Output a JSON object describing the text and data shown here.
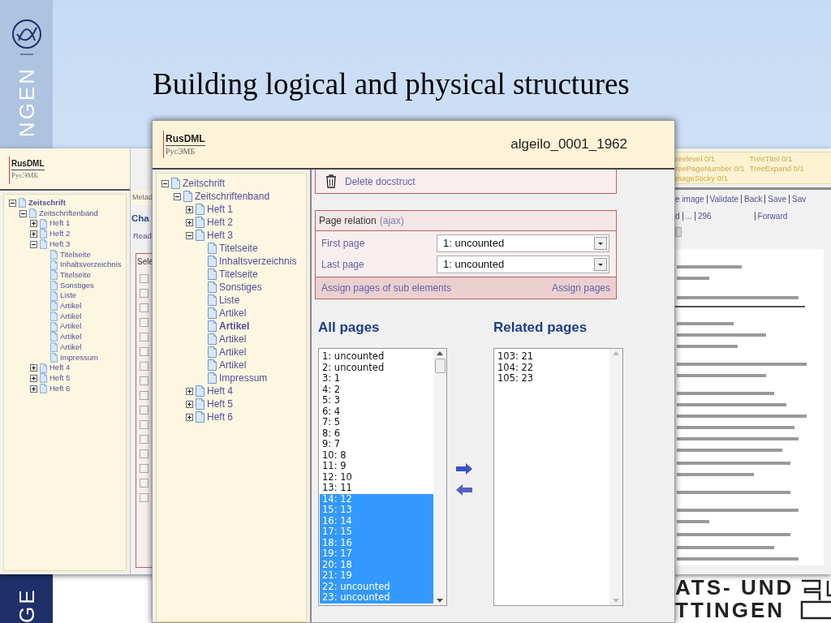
{
  "slide": {
    "title": "Building logical and physical structures",
    "side_text_top": "NGEN",
    "side_text_bottom": "GE",
    "footer_lines": [
      "ATS- UND",
      "TTINGEN"
    ]
  },
  "back_window": {
    "logo": {
      "name": "RusDML",
      "sub": "РусЭМБ"
    },
    "tree": [
      {
        "label": "Zeitschrift",
        "expanded": true,
        "selected": true,
        "children": [
          {
            "label": "Zeitschriftenband",
            "expanded": true,
            "selected": false,
            "children": [
              {
                "label": "Heft 1",
                "expanded": false,
                "selected": false
              },
              {
                "label": "Heft 2",
                "expanded": false,
                "selected": false
              },
              {
                "label": "Heft 3",
                "expanded": true,
                "selected": false,
                "children": [
                  {
                    "label": "Titelseite",
                    "selected": false
                  },
                  {
                    "label": "Inhaltsverzeichnis",
                    "selected": false
                  },
                  {
                    "label": "Titelseite",
                    "selected": false
                  },
                  {
                    "label": "Sonstiges",
                    "selected": false
                  },
                  {
                    "label": "Liste",
                    "selected": false
                  },
                  {
                    "label": "Artikel",
                    "selected": false
                  },
                  {
                    "label": "Artikel",
                    "selected": false
                  },
                  {
                    "label": "Artikel",
                    "selected": false
                  },
                  {
                    "label": "Artikel",
                    "selected": false
                  },
                  {
                    "label": "Artikel",
                    "selected": false
                  },
                  {
                    "label": "Impressum",
                    "selected": false
                  }
                ]
              },
              {
                "label": "Heft 4",
                "expanded": false,
                "selected": false
              },
              {
                "label": "Heft 5",
                "expanded": false,
                "selected": false
              },
              {
                "label": "Heft 6",
                "expanded": false,
                "selected": false
              }
            ]
          }
        ]
      }
    ],
    "strip": {
      "tab": "Metad",
      "heading": "Cha",
      "link": "Read",
      "box_header": "Sele",
      "checkboxes": [
        {
          "checked": false
        },
        {
          "checked": false
        },
        {
          "checked": false
        },
        {
          "checked": false
        },
        {
          "checked": false
        },
        {
          "checked": false
        },
        {
          "checked": false
        },
        {
          "checked": false
        },
        {
          "checked": false
        },
        {
          "checked": false
        },
        {
          "checked": false
        },
        {
          "checked": false
        },
        {
          "checked": false
        },
        {
          "checked": false
        },
        {
          "checked": false
        },
        {
          "checked": false
        }
      ]
    },
    "fields": [
      [
        "reelevel 0/1",
        "TreeTitel 0/1"
      ],
      [
        "reePageNumber 0/1",
        "TreeExpand 0/1"
      ],
      [
        "mageSticky 0/1"
      ]
    ],
    "actions": [
      "e image",
      "Validate",
      "Back",
      "Save",
      "Sav"
    ],
    "pager": [
      "d",
      "...",
      "296"
    ],
    "forward": "Forward"
  },
  "front_window": {
    "logo": {
      "name": "RusDML",
      "sub": "РусЭМБ"
    },
    "title": "algeilo_0001_1962",
    "tree": [
      {
        "label": "Zeitschrift",
        "expanded": true,
        "selected": false,
        "children": [
          {
            "label": "Zeitschriftenband",
            "expanded": true,
            "selected": false,
            "children": [
              {
                "label": "Heft 1",
                "expanded": false,
                "selected": false
              },
              {
                "label": "Heft 2",
                "expanded": false,
                "selected": false
              },
              {
                "label": "Heft 3",
                "expanded": true,
                "selected": false,
                "children": [
                  {
                    "label": "Titelseite",
                    "selected": false
                  },
                  {
                    "label": "Inhaltsverzeichnis",
                    "selected": false
                  },
                  {
                    "label": "Titelseite",
                    "selected": false
                  },
                  {
                    "label": "Sonstiges",
                    "selected": false
                  },
                  {
                    "label": "Liste",
                    "selected": false
                  },
                  {
                    "label": "Artikel",
                    "selected": false
                  },
                  {
                    "label": "Artikel",
                    "selected": true
                  },
                  {
                    "label": "Artikel",
                    "selected": false
                  },
                  {
                    "label": "Artikel",
                    "selected": false
                  },
                  {
                    "label": "Artikel",
                    "selected": false
                  },
                  {
                    "label": "Impressum",
                    "selected": false
                  }
                ]
              },
              {
                "label": "Heft 4",
                "expanded": false,
                "selected": false
              },
              {
                "label": "Heft 5",
                "expanded": false,
                "selected": false
              },
              {
                "label": "Heft 6",
                "expanded": false,
                "selected": false
              }
            ]
          }
        ]
      }
    ],
    "delete_label": "Delete docstruct",
    "page_relation": {
      "title": "Page relation",
      "ajax": "(ajax)",
      "rows": [
        {
          "label": "First page",
          "value": "1: uncounted"
        },
        {
          "label": "Last page",
          "value": "1: uncounted"
        }
      ],
      "assign_sub": "Assign pages of sub elements",
      "assign": "Assign pages"
    },
    "all_pages": {
      "title": "All pages",
      "items": [
        {
          "label": "1: uncounted",
          "selected": false
        },
        {
          "label": "2: uncounted",
          "selected": false
        },
        {
          "label": "3: 1",
          "selected": false
        },
        {
          "label": "4: 2",
          "selected": false
        },
        {
          "label": "5: 3",
          "selected": false
        },
        {
          "label": "6: 4",
          "selected": false
        },
        {
          "label": "7: 5",
          "selected": false
        },
        {
          "label": "8: 6",
          "selected": false
        },
        {
          "label": "9: 7",
          "selected": false
        },
        {
          "label": "10: 8",
          "selected": false
        },
        {
          "label": "11: 9",
          "selected": false
        },
        {
          "label": "12: 10",
          "selected": false
        },
        {
          "label": "13: 11",
          "selected": false
        },
        {
          "label": "14: 12",
          "selected": true
        },
        {
          "label": "15: 13",
          "selected": true
        },
        {
          "label": "16: 14",
          "selected": true
        },
        {
          "label": "17: 15",
          "selected": true
        },
        {
          "label": "18: 16",
          "selected": true
        },
        {
          "label": "19: 17",
          "selected": true
        },
        {
          "label": "20: 18",
          "selected": true
        },
        {
          "label": "21: 19",
          "selected": true
        },
        {
          "label": "22: uncounted",
          "selected": true
        },
        {
          "label": "23: uncounted",
          "selected": true
        }
      ]
    },
    "related_pages": {
      "title": "Related pages",
      "items": [
        "103: 21",
        "104: 22",
        "105: 23"
      ]
    }
  }
}
